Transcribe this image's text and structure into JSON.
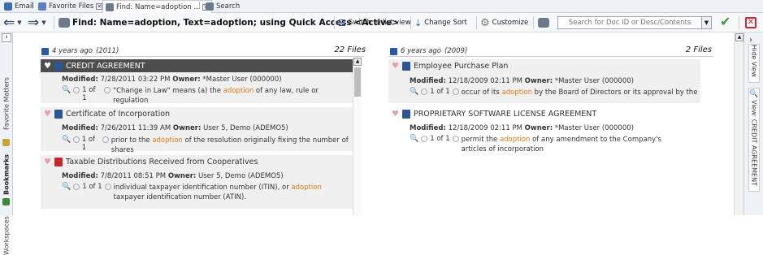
{
  "tabs": [
    {
      "label": "Email",
      "active": false,
      "closable": false,
      "icon": "email-icon"
    },
    {
      "label": "Favorite Files",
      "active": false,
      "closable": true,
      "icon": "favorite-icon"
    },
    {
      "label": "Find: Name=adoption ...",
      "active": true,
      "closable": true,
      "icon": "binoculars-icon"
    },
    {
      "label": "Search",
      "active": false,
      "closable": false,
      "icon": "binoculars-icon"
    }
  ],
  "toolbar": {
    "find_title": "Find: Name=adoption, Text=adoption; using Quick Access <Active>",
    "switch_list_label": "Switch to list view",
    "change_sort_label": "Change Sort",
    "customize_label": "Customize",
    "search_placeholder": "Search for Doc ID or Desc/Contents"
  },
  "left_rail": {
    "tabs": [
      "Favorite Matters",
      "Bookmarks",
      "Workspaces"
    ]
  },
  "right_rail": {
    "tabs": [
      "Hide View",
      "View: CREDIT AGREEMENT"
    ]
  },
  "columns": [
    {
      "age": "4 years ago",
      "year": "(2011)",
      "count": "22 Files",
      "items": [
        {
          "title": "CREDIT AGREEMENT",
          "selected": true,
          "doctype": "word",
          "modified": "7/28/2011 03:22 PM",
          "owner": "*Master User (000000)",
          "hits": "1 of 1",
          "before": "\"Change in Law\" means (a) the ",
          "keyword": "adoption",
          "after": " of any law, rule or regulation"
        },
        {
          "title": "Certificate of Incorporation",
          "selected": false,
          "doctype": "word",
          "modified": "7/26/2011 11:39 AM",
          "owner": "User 5, Demo (ADEMO5)",
          "hits": "1 of 1",
          "before": "prior to the ",
          "keyword": "adoption",
          "after": " of the resolution originally fixing the number of shares"
        },
        {
          "title": "Taxable Distributions Received from Cooperatives",
          "selected": false,
          "doctype": "pdf",
          "modified": "7/8/2011 08:51 PM",
          "owner": "User 5, Demo (ADEMO5)",
          "hits": "1 of 1",
          "before": "individual taxpayer identification number (ITIN), or ",
          "keyword": "adoption",
          "after": " taxpayer identification number (ATIN)."
        }
      ]
    },
    {
      "age": "6 years ago",
      "year": "(2009)",
      "count": "2 Files",
      "items": [
        {
          "title": "Employee Purchase Plan",
          "selected": false,
          "doctype": "word",
          "modified": "12/18/2009 02:11 PM",
          "owner": "*Master User (000000)",
          "hits": "1 of 1",
          "before": "occur of its ",
          "keyword": "adoption",
          "after": " by the Board of Directors or its approval by the"
        },
        {
          "title": "PROPRIETARY SOFTWARE LICENSE AGREEMENT",
          "selected": false,
          "doctype": "word",
          "modified": "12/18/2009 02:11 PM",
          "owner": "*Master User (000000)",
          "hits": "1 of 1",
          "before": "permit the ",
          "keyword": "adoption",
          "after": " of any amendment to the Company's articles of incorporation"
        }
      ]
    }
  ],
  "labels": {
    "modified": "Modified:",
    "owner": "Owner:"
  },
  "colors": {
    "keyword": "#e07a1a",
    "selected_title_bg": "#4d4d4d",
    "card_bg": "#f0f0f0",
    "accent": "#2c5aa0"
  }
}
